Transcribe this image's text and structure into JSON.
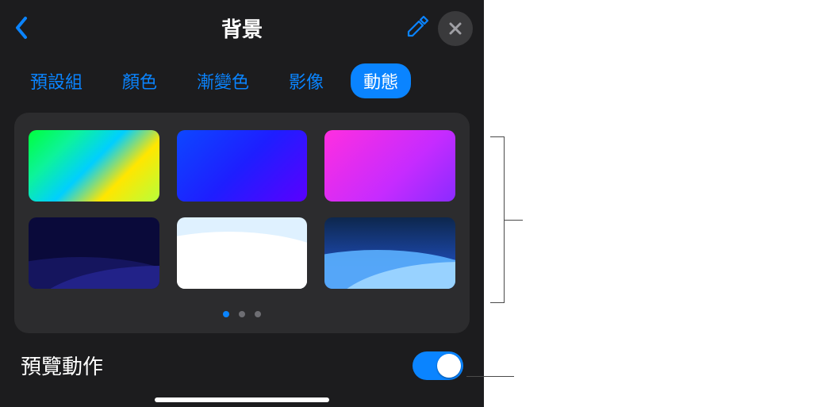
{
  "header": {
    "title": "背景"
  },
  "tabs": [
    {
      "label": "預設組",
      "active": false
    },
    {
      "label": "顏色",
      "active": false
    },
    {
      "label": "漸變色",
      "active": false
    },
    {
      "label": "影像",
      "active": false
    },
    {
      "label": "動態",
      "active": true
    }
  ],
  "gallery": {
    "items": [
      {
        "name": "gradient-green-yellow"
      },
      {
        "name": "gradient-blue"
      },
      {
        "name": "gradient-magenta"
      },
      {
        "name": "landscape-dark-blue"
      },
      {
        "name": "landscape-white"
      },
      {
        "name": "landscape-teal-blue"
      }
    ],
    "page_count": 3,
    "current_page": 0
  },
  "footer": {
    "preview_label": "預覽動作",
    "preview_on": true
  },
  "icons": {
    "back": "chevron-left",
    "eyedropper": "eyedropper",
    "close": "xmark"
  }
}
